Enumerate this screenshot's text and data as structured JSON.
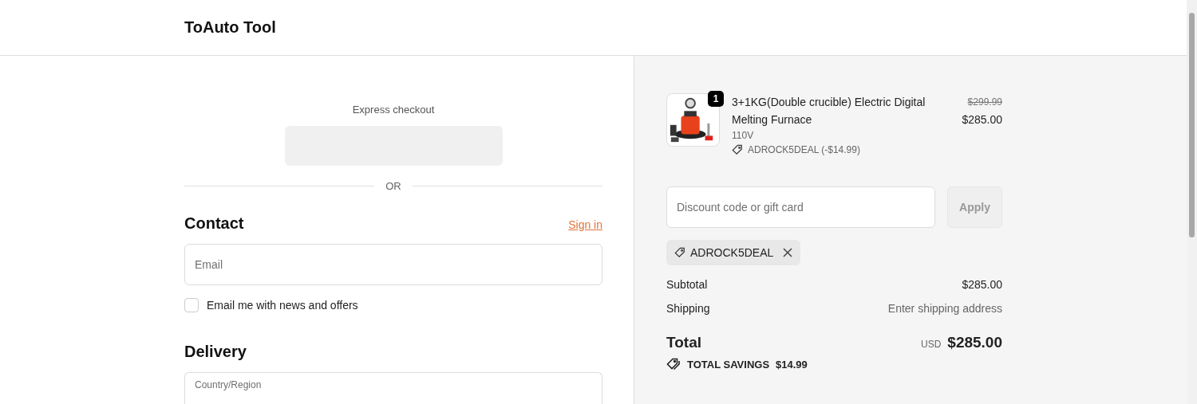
{
  "header": {
    "store_name": "ToAuto Tool"
  },
  "checkout": {
    "express_checkout_label": "Express checkout",
    "divider_label": "OR",
    "contact": {
      "heading": "Contact",
      "sign_in_link": "Sign in",
      "email_field": {
        "placeholder": "Email"
      },
      "newsletter": {
        "label": "Email me with news and offers",
        "checked": false
      }
    },
    "delivery": {
      "heading": "Delivery",
      "country_field": {
        "label": "Country/Region"
      }
    }
  },
  "order_summary": {
    "items": [
      {
        "kind": "picture",
        "quantity": "1",
        "title": "3+1KG(Double crucible) Electric Digital Melting Furnace",
        "variant": "110V",
        "discount": "ADROCK5DEAL (-$14.99)",
        "original_price": "$299.99",
        "price": "$285.00"
      }
    ],
    "discount_field": {
      "placeholder": "Discount code or gift card"
    },
    "apply_button": {
      "label": "Apply",
      "disabled": true
    },
    "applied_codes": [
      {
        "code": "ADROCK5DEAL"
      }
    ],
    "lines": [
      {
        "label": "Subtotal",
        "value": "$285.00",
        "kind": "amount"
      },
      {
        "label": "Shipping",
        "value": "Enter shipping address",
        "kind": "hint"
      }
    ],
    "total": {
      "label": "Total",
      "currency": "USD",
      "amount": "$285.00"
    },
    "savings": {
      "label": "TOTAL SAVINGS",
      "amount": "$14.99"
    }
  }
}
